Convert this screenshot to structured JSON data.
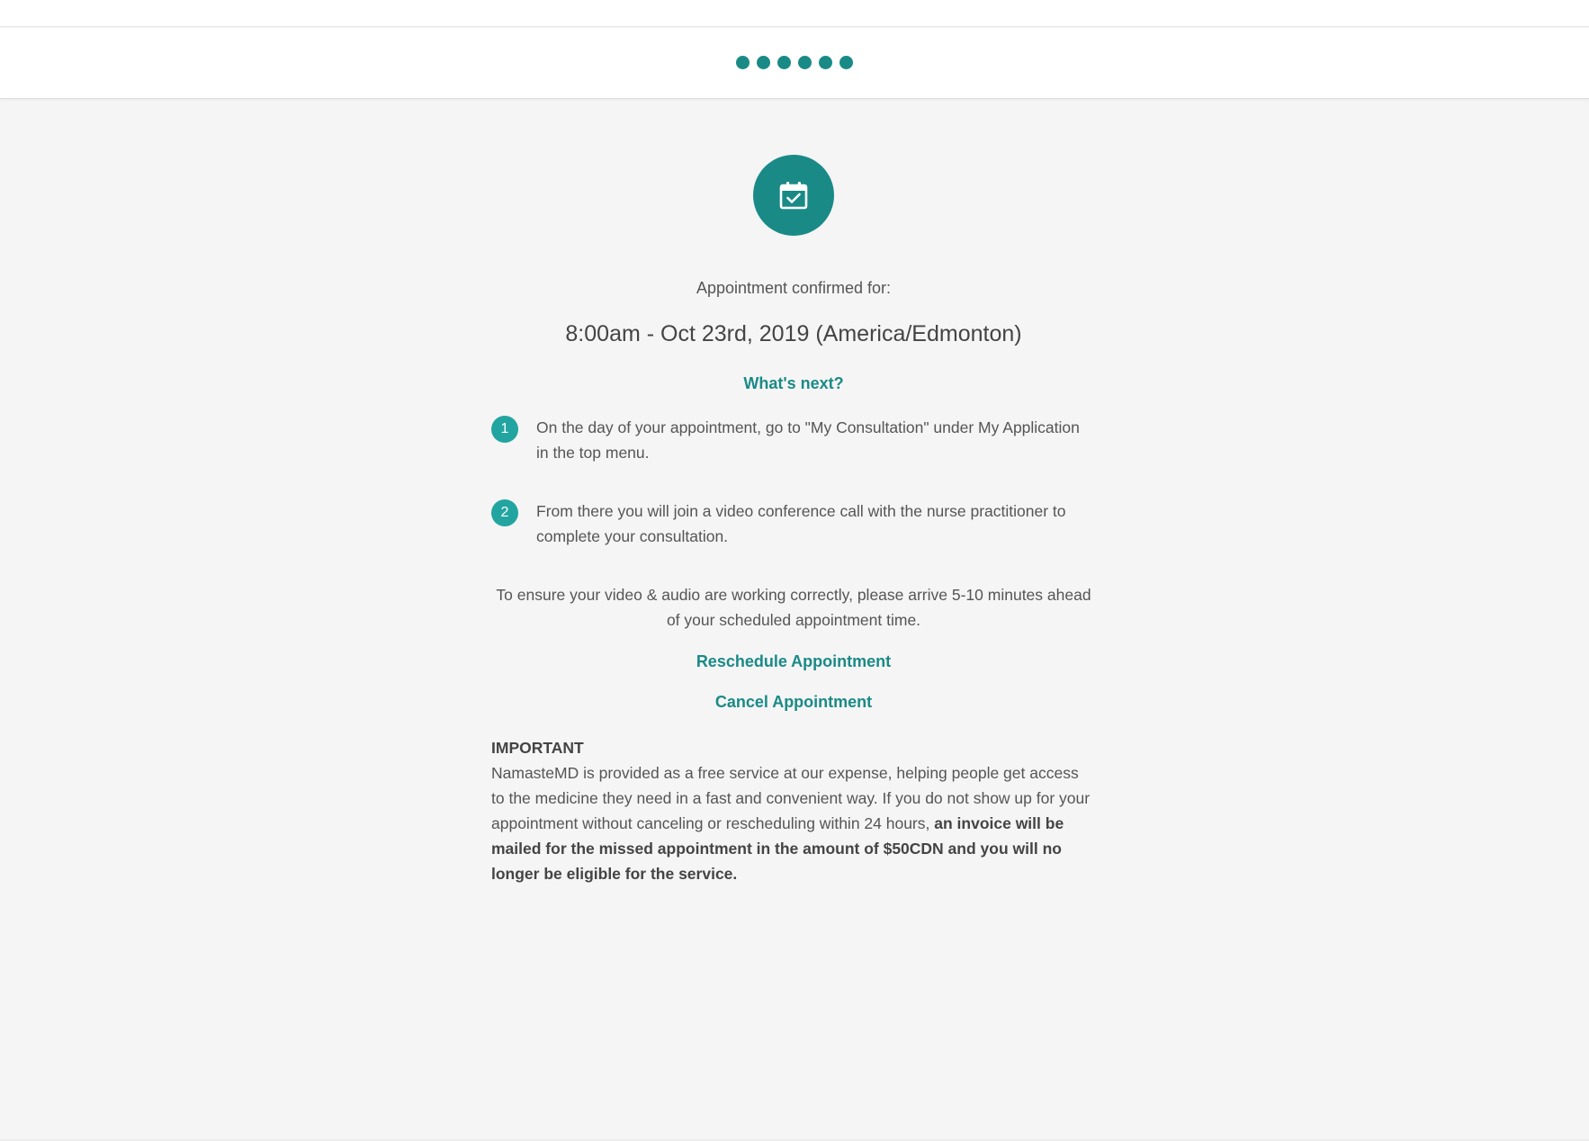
{
  "progress": {
    "step_count": 6,
    "color": "#1a8a87"
  },
  "icon": {
    "name": "calendar-check-icon",
    "background": "#1a8a87"
  },
  "confirmation": {
    "label": "Appointment confirmed for:",
    "datetime": "8:00am - Oct 23rd, 2019 (America/Edmonton)"
  },
  "next_steps": {
    "heading": "What's next?",
    "items": [
      {
        "number": "1",
        "text": "On the day of your appointment, go to \"My Consultation\" under My Application in the top menu."
      },
      {
        "number": "2",
        "text": "From there you will join a video conference call with the nurse practitioner to complete your consultation."
      }
    ]
  },
  "note": "To ensure your video & audio are working correctly, please arrive 5-10 minutes ahead of your scheduled appointment time.",
  "actions": {
    "reschedule_label": "Reschedule Appointment",
    "cancel_label": "Cancel Appointment"
  },
  "important": {
    "title": "IMPORTANT",
    "text": "NamasteMD is provided as a free service at our expense, helping people get access to the medicine they need in a fast and convenient way. If you do not show up for your appointment without canceling or rescheduling within 24 hours, ",
    "bold_text": "an invoice will be mailed for the missed appointment in the amount of $50CDN and you will no longer be eligible for the service."
  }
}
